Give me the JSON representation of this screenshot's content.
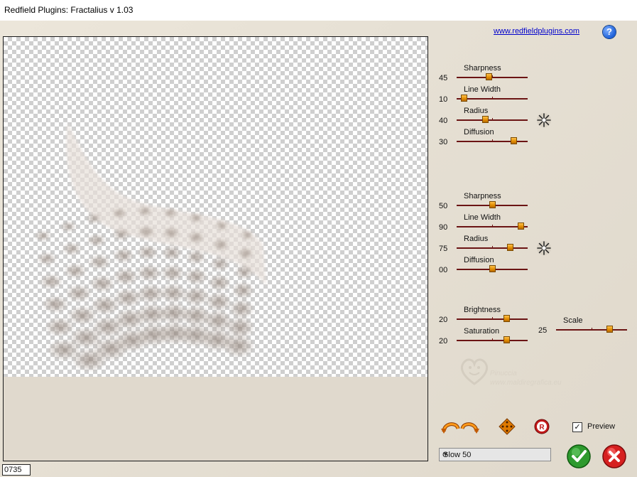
{
  "window": {
    "title": "Redfield Plugins: Fractalius v 1.03"
  },
  "header": {
    "link": "www.redfieldplugins.com",
    "help_icon": "question-icon",
    "help_glyph": "?"
  },
  "status": {
    "counter": "0735"
  },
  "group1": [
    {
      "label": "Sharpness",
      "value": "45",
      "level": 0.45
    },
    {
      "label": "Line Width",
      "value": "10",
      "level": 0.1
    },
    {
      "label": "Radius",
      "value": "40",
      "level": 0.4
    },
    {
      "label": "Diffusion",
      "value": "30",
      "level": 0.8
    }
  ],
  "group2": [
    {
      "label": "Sharpness",
      "value": "50",
      "level": 0.5
    },
    {
      "label": "Line Width",
      "value": "90",
      "level": 0.9
    },
    {
      "label": "Radius",
      "value": "75",
      "level": 0.75
    },
    {
      "label": "Diffusion",
      "value": "00",
      "level": 0.5
    }
  ],
  "group3": [
    {
      "label": "Brightness",
      "value": "20",
      "level": 0.7
    },
    {
      "label": "Saturation",
      "value": "20",
      "level": 0.7
    }
  ],
  "scale": {
    "label": "Scale",
    "value": "25",
    "level": 0.75
  },
  "controls": {
    "preview_label": "Preview",
    "preview_checked": true,
    "preset_selected": "Glow 50",
    "check_mark": "✓"
  },
  "watermark": {
    "line1": "Pinuccia",
    "line2": "www.maldiregrafica.eu"
  },
  "colors": {
    "thumb": "#e08a00",
    "track": "#6b1414",
    "ok": "#2e9a2e",
    "cancel": "#d62020",
    "link": "#0000cc"
  }
}
